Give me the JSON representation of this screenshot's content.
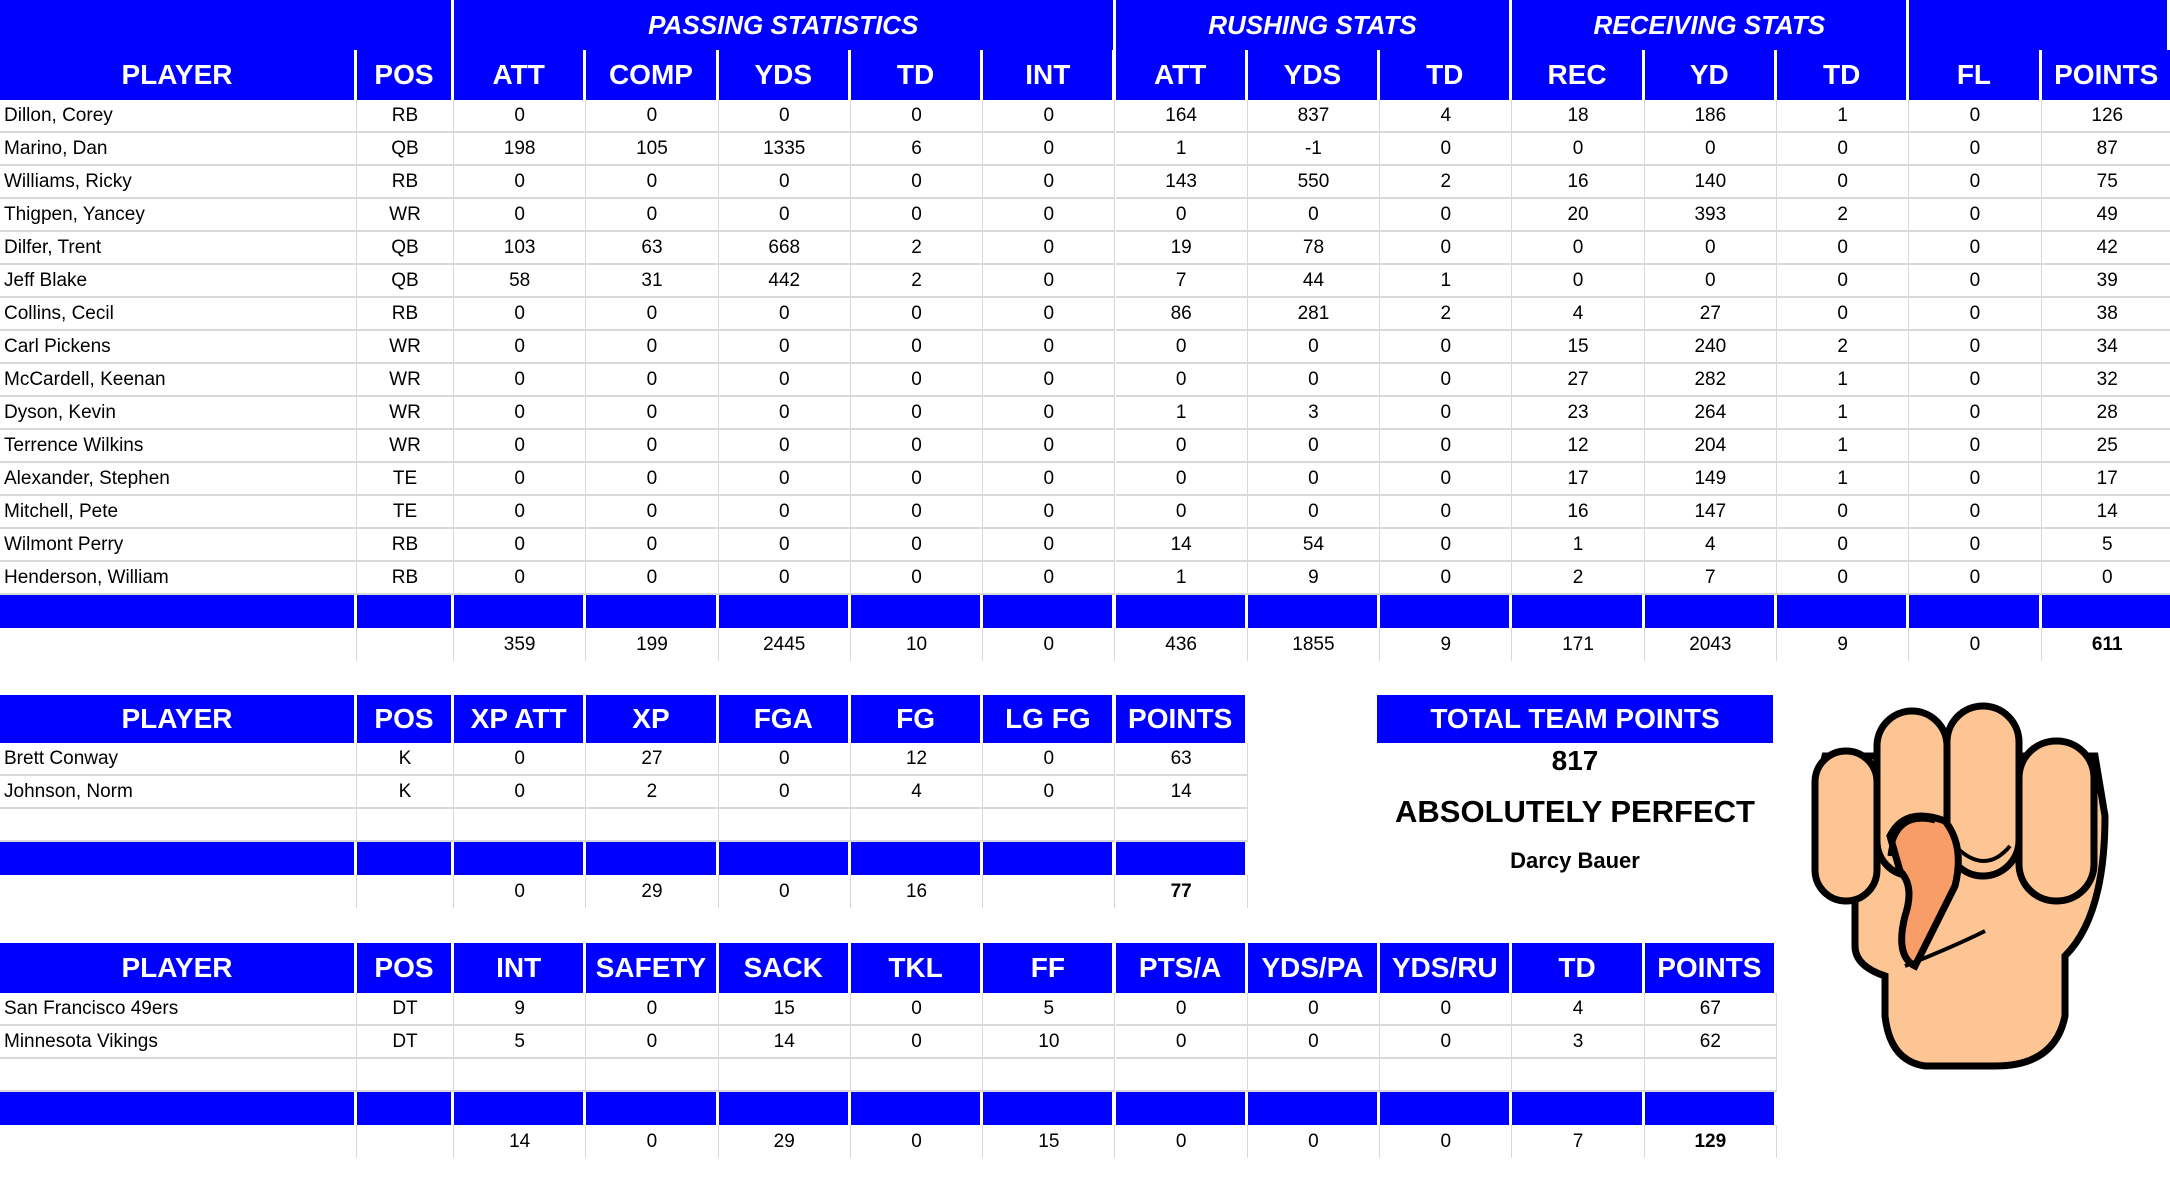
{
  "offense": {
    "group_titles": [
      {
        "label": "PASSING STATISTICS",
        "from": 2,
        "to": 6
      },
      {
        "label": "RUSHING STATS",
        "from": 7,
        "to": 9
      },
      {
        "label": "RECEIVING STATS",
        "from": 10,
        "to": 12
      }
    ],
    "headers": [
      "PLAYER",
      "POS",
      "ATT",
      "COMP",
      "YDS",
      "TD",
      "INT",
      "ATT",
      "YDS",
      "TD",
      "REC",
      "YD",
      "TD",
      "FL",
      "POINTS"
    ],
    "rows": [
      [
        "Dillon, Corey",
        "RB",
        "0",
        "0",
        "0",
        "0",
        "0",
        "164",
        "837",
        "4",
        "18",
        "186",
        "1",
        "0",
        "126"
      ],
      [
        "Marino, Dan",
        "QB",
        "198",
        "105",
        "1335",
        "6",
        "0",
        "1",
        "-1",
        "0",
        "0",
        "0",
        "0",
        "0",
        "87"
      ],
      [
        "Williams, Ricky",
        "RB",
        "0",
        "0",
        "0",
        "0",
        "0",
        "143",
        "550",
        "2",
        "16",
        "140",
        "0",
        "0",
        "75"
      ],
      [
        "Thigpen, Yancey",
        "WR",
        "0",
        "0",
        "0",
        "0",
        "0",
        "0",
        "0",
        "0",
        "20",
        "393",
        "2",
        "0",
        "49"
      ],
      [
        "Dilfer, Trent",
        "QB",
        "103",
        "63",
        "668",
        "2",
        "0",
        "19",
        "78",
        "0",
        "0",
        "0",
        "0",
        "0",
        "42"
      ],
      [
        "Jeff Blake",
        "QB",
        "58",
        "31",
        "442",
        "2",
        "0",
        "7",
        "44",
        "1",
        "0",
        "0",
        "0",
        "0",
        "39"
      ],
      [
        "Collins, Cecil",
        "RB",
        "0",
        "0",
        "0",
        "0",
        "0",
        "86",
        "281",
        "2",
        "4",
        "27",
        "0",
        "0",
        "38"
      ],
      [
        "Carl Pickens",
        "WR",
        "0",
        "0",
        "0",
        "0",
        "0",
        "0",
        "0",
        "0",
        "15",
        "240",
        "2",
        "0",
        "34"
      ],
      [
        "McCardell, Keenan",
        "WR",
        "0",
        "0",
        "0",
        "0",
        "0",
        "0",
        "0",
        "0",
        "27",
        "282",
        "1",
        "0",
        "32"
      ],
      [
        "Dyson, Kevin",
        "WR",
        "0",
        "0",
        "0",
        "0",
        "0",
        "1",
        "3",
        "0",
        "23",
        "264",
        "1",
        "0",
        "28"
      ],
      [
        "Terrence Wilkins",
        "WR",
        "0",
        "0",
        "0",
        "0",
        "0",
        "0",
        "0",
        "0",
        "12",
        "204",
        "1",
        "0",
        "25"
      ],
      [
        "Alexander, Stephen",
        "TE",
        "0",
        "0",
        "0",
        "0",
        "0",
        "0",
        "0",
        "0",
        "17",
        "149",
        "1",
        "0",
        "17"
      ],
      [
        "Mitchell, Pete",
        "TE",
        "0",
        "0",
        "0",
        "0",
        "0",
        "0",
        "0",
        "0",
        "16",
        "147",
        "0",
        "0",
        "14"
      ],
      [
        "Wilmont Perry",
        "RB",
        "0",
        "0",
        "0",
        "0",
        "0",
        "14",
        "54",
        "0",
        "1",
        "4",
        "0",
        "0",
        "5"
      ],
      [
        "Henderson, William",
        "RB",
        "0",
        "0",
        "0",
        "0",
        "0",
        "1",
        "9",
        "0",
        "2",
        "7",
        "0",
        "0",
        "0"
      ]
    ],
    "totals": [
      "",
      "",
      "359",
      "199",
      "2445",
      "10",
      "0",
      "436",
      "1855",
      "9",
      "171",
      "2043",
      "9",
      "0",
      "611"
    ]
  },
  "kickers": {
    "headers": [
      "PLAYER",
      "POS",
      "XP ATT",
      "XP",
      "FGA",
      "FG",
      "LG FG",
      "POINTS"
    ],
    "rows": [
      [
        "Brett Conway",
        "K",
        "0",
        "27",
        "0",
        "12",
        "0",
        "63"
      ],
      [
        "Johnson, Norm",
        "K",
        "0",
        "2",
        "0",
        "4",
        "0",
        "14"
      ],
      [
        "",
        "",
        "",
        "",
        "",
        "",
        "",
        ""
      ]
    ],
    "totals": [
      "",
      "",
      "0",
      "29",
      "0",
      "16",
      "",
      "77"
    ]
  },
  "defense": {
    "headers": [
      "PLAYER",
      "POS",
      "INT",
      "SAFETY",
      "SACK",
      "TKL",
      "FF",
      "PTS/A",
      "YDS/PA",
      "YDS/RU",
      "TD",
      "POINTS"
    ],
    "rows": [
      [
        "San Francisco 49ers",
        "DT",
        "9",
        "0",
        "15",
        "0",
        "5",
        "0",
        "0",
        "0",
        "4",
        "67"
      ],
      [
        "Minnesota Vikings",
        "DT",
        "5",
        "0",
        "14",
        "0",
        "10",
        "0",
        "0",
        "0",
        "3",
        "62"
      ],
      [
        "",
        "",
        "",
        "",
        "",
        "",
        "",
        "",
        "",
        "",
        "",
        ""
      ]
    ],
    "totals": [
      "",
      "",
      "14",
      "0",
      "29",
      "0",
      "15",
      "0",
      "0",
      "0",
      "7",
      "129"
    ]
  },
  "summary": {
    "title": "TOTAL TEAM POINTS",
    "total": "817",
    "rating": "ABSOLUTELY PERFECT",
    "owner": "Darcy Bauer"
  },
  "image": {
    "icon": "raised-fist-icon"
  },
  "colors": {
    "header_blue": "#0000ff",
    "grid": "#d8d8d8"
  }
}
